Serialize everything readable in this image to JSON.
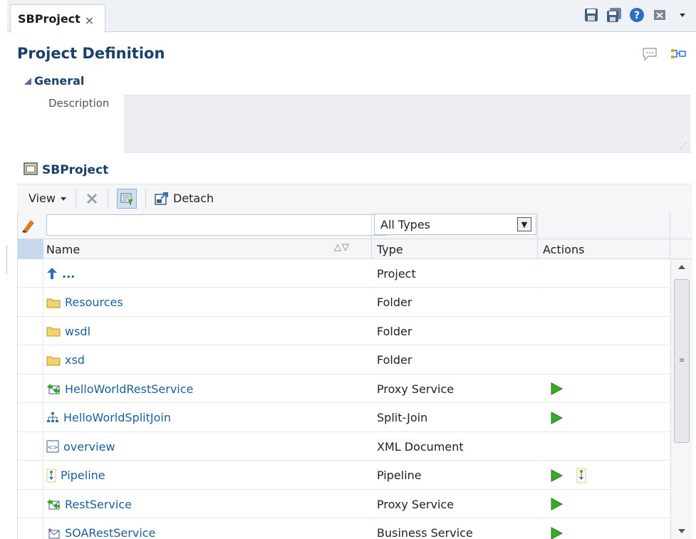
{
  "tab": {
    "label": "SBProject",
    "close": "×"
  },
  "page": {
    "title": "Project Definition"
  },
  "general": {
    "label": "General",
    "description_label": "Description",
    "description_value": ""
  },
  "project": {
    "label": "SBProject"
  },
  "toolbar": {
    "view_label": "View",
    "detach_label": "Detach"
  },
  "filter": {
    "search_value": "",
    "type_selected": "All Types"
  },
  "columns": {
    "name": "Name",
    "type": "Type",
    "actions": "Actions"
  },
  "rows": [
    {
      "name": "...",
      "icon": "up-arrow-icon",
      "type": "Project",
      "actions": []
    },
    {
      "name": "Resources",
      "icon": "folder-icon",
      "type": "Folder",
      "actions": []
    },
    {
      "name": "wsdl",
      "icon": "folder-icon",
      "type": "Folder",
      "actions": []
    },
    {
      "name": "xsd",
      "icon": "folder-icon",
      "type": "Folder",
      "actions": []
    },
    {
      "name": "HelloWorldRestService",
      "icon": "proxy-service-icon",
      "type": "Proxy Service",
      "actions": [
        "run"
      ]
    },
    {
      "name": "HelloWorldSplitJoin",
      "icon": "split-join-icon",
      "type": "Split-Join",
      "actions": [
        "run"
      ]
    },
    {
      "name": "overview",
      "icon": "xml-document-icon",
      "type": "XML Document",
      "actions": []
    },
    {
      "name": "Pipeline",
      "icon": "pipeline-icon",
      "type": "Pipeline",
      "actions": [
        "run",
        "pipeline"
      ]
    },
    {
      "name": "RestService",
      "icon": "proxy-service-icon",
      "type": "Proxy Service",
      "actions": [
        "run"
      ]
    },
    {
      "name": "SOARestService",
      "icon": "business-service-icon",
      "type": "Business Service",
      "actions": [
        "run"
      ]
    }
  ],
  "colors": {
    "title": "#1a3f6b",
    "link": "#1b5e9b",
    "run": "#3aa82b",
    "folder": "#f1d36b"
  }
}
